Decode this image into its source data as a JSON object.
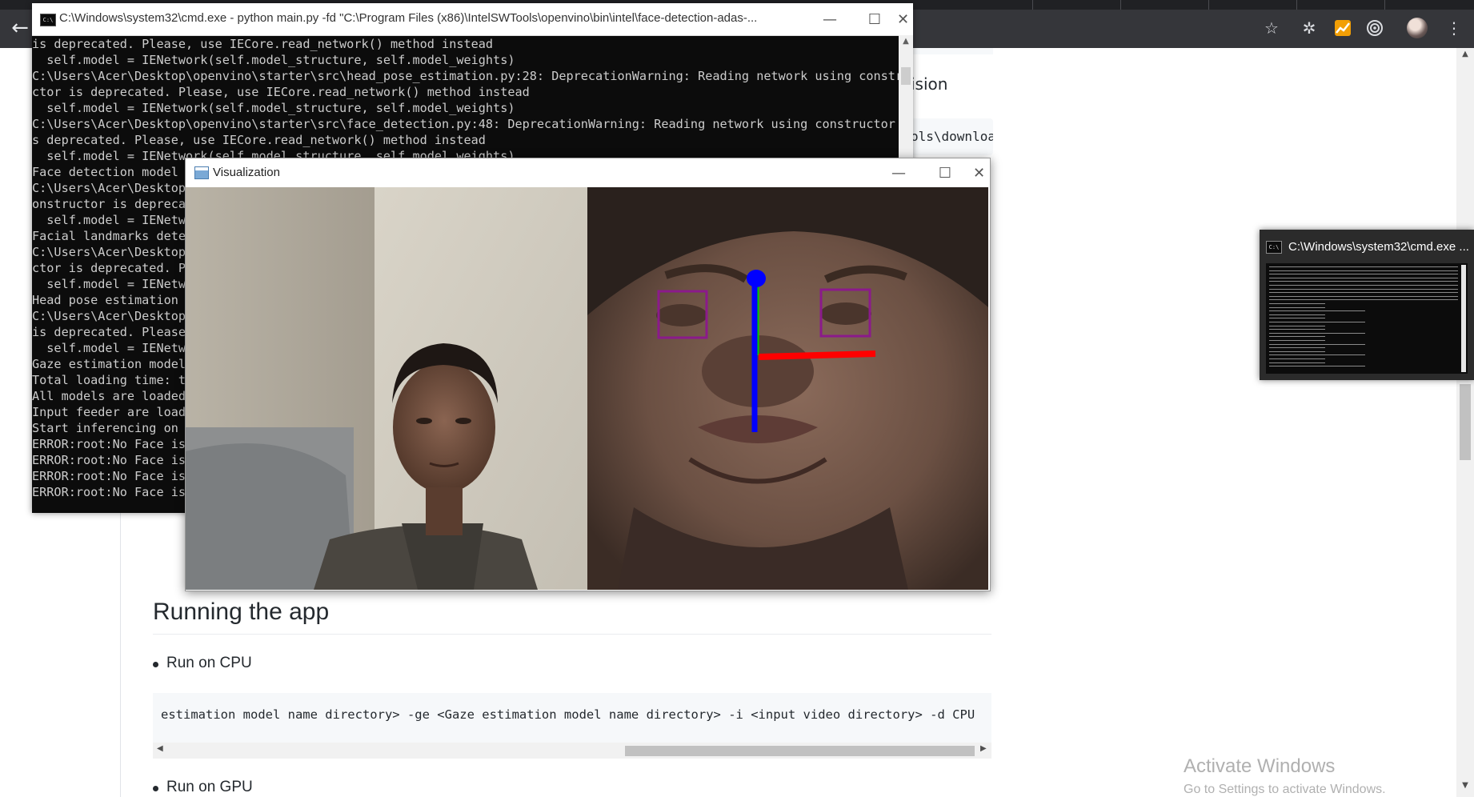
{
  "browser": {
    "back_glyph": "←",
    "toolbar_icons": [
      "star-icon",
      "extensions-icon",
      "chart-extension-icon",
      "target-extension-icon",
      "avatar",
      "menu-icon"
    ]
  },
  "page": {
    "peek_heading_fragment": "ision",
    "peek_code_fragment": "ols\\downloa",
    "section_heading": "Running the app",
    "bullet_cpu": "Run on CPU",
    "code_line": "estimation model name directory> -ge <Gaze estimation model name directory> -i <input video directory> -d CPU",
    "bullet_gpu": "Run on GPU"
  },
  "cmd": {
    "title": "C:\\Windows\\system32\\cmd.exe - python  main.py -fd \"C:\\Program Files (x86)\\IntelSWTools\\openvino\\bin\\intel\\face-detection-adas-...",
    "lines": [
      "is deprecated. Please, use IECore.read_network() method instead",
      "  self.model = IENetwork(self.model_structure, self.model_weights)",
      "C:\\Users\\Acer\\Desktop\\openvino\\starter\\src\\head_pose_estimation.py:28: DeprecationWarning: Reading network using constru",
      "ctor is deprecated. Please, use IECore.read_network() method instead",
      "  self.model = IENetwork(self.model_structure, self.model_weights)",
      "C:\\Users\\Acer\\Desktop\\openvino\\starter\\src\\face_detection.py:48: DeprecationWarning: Reading network using constructor i",
      "s deprecated. Please, use IECore.read_network() method instead",
      "  self.model = IENetwork(self.model_structure, self.model_weights)",
      "Face detection model",
      "C:\\Users\\Acer\\Desktop",
      "onstructor is depreca",
      "  self.model = IENetw",
      "Facial landmarks dete",
      "C:\\Users\\Acer\\Desktop",
      "ctor is deprecated. P",
      "  self.model = IENetw",
      "Head pose estimation",
      "C:\\Users\\Acer\\Desktop",
      "is deprecated. Please",
      "  self.model = IENetw",
      "Gaze estimation model",
      "Total loading time: t",
      "All models are loaded",
      "Input feeder are load",
      "Start inferencing on",
      "ERROR:root:No Face is",
      "ERROR:root:No Face is",
      "ERROR:root:No Face is",
      "ERROR:root:No Face is"
    ]
  },
  "viz": {
    "title": "Visualization"
  },
  "thumbnail": {
    "title": "C:\\Windows\\system32\\cmd.exe ..."
  },
  "watermark": {
    "title": "Activate Windows",
    "subtitle": "Go to Settings to activate Windows."
  },
  "colors": {
    "console_bg": "#0c0c0c",
    "console_text": "#cccccc",
    "eye_box": "#8b1a8b",
    "axis_x": "#ff0000",
    "axis_y": "#00c800",
    "axis_z": "#0000ff"
  }
}
